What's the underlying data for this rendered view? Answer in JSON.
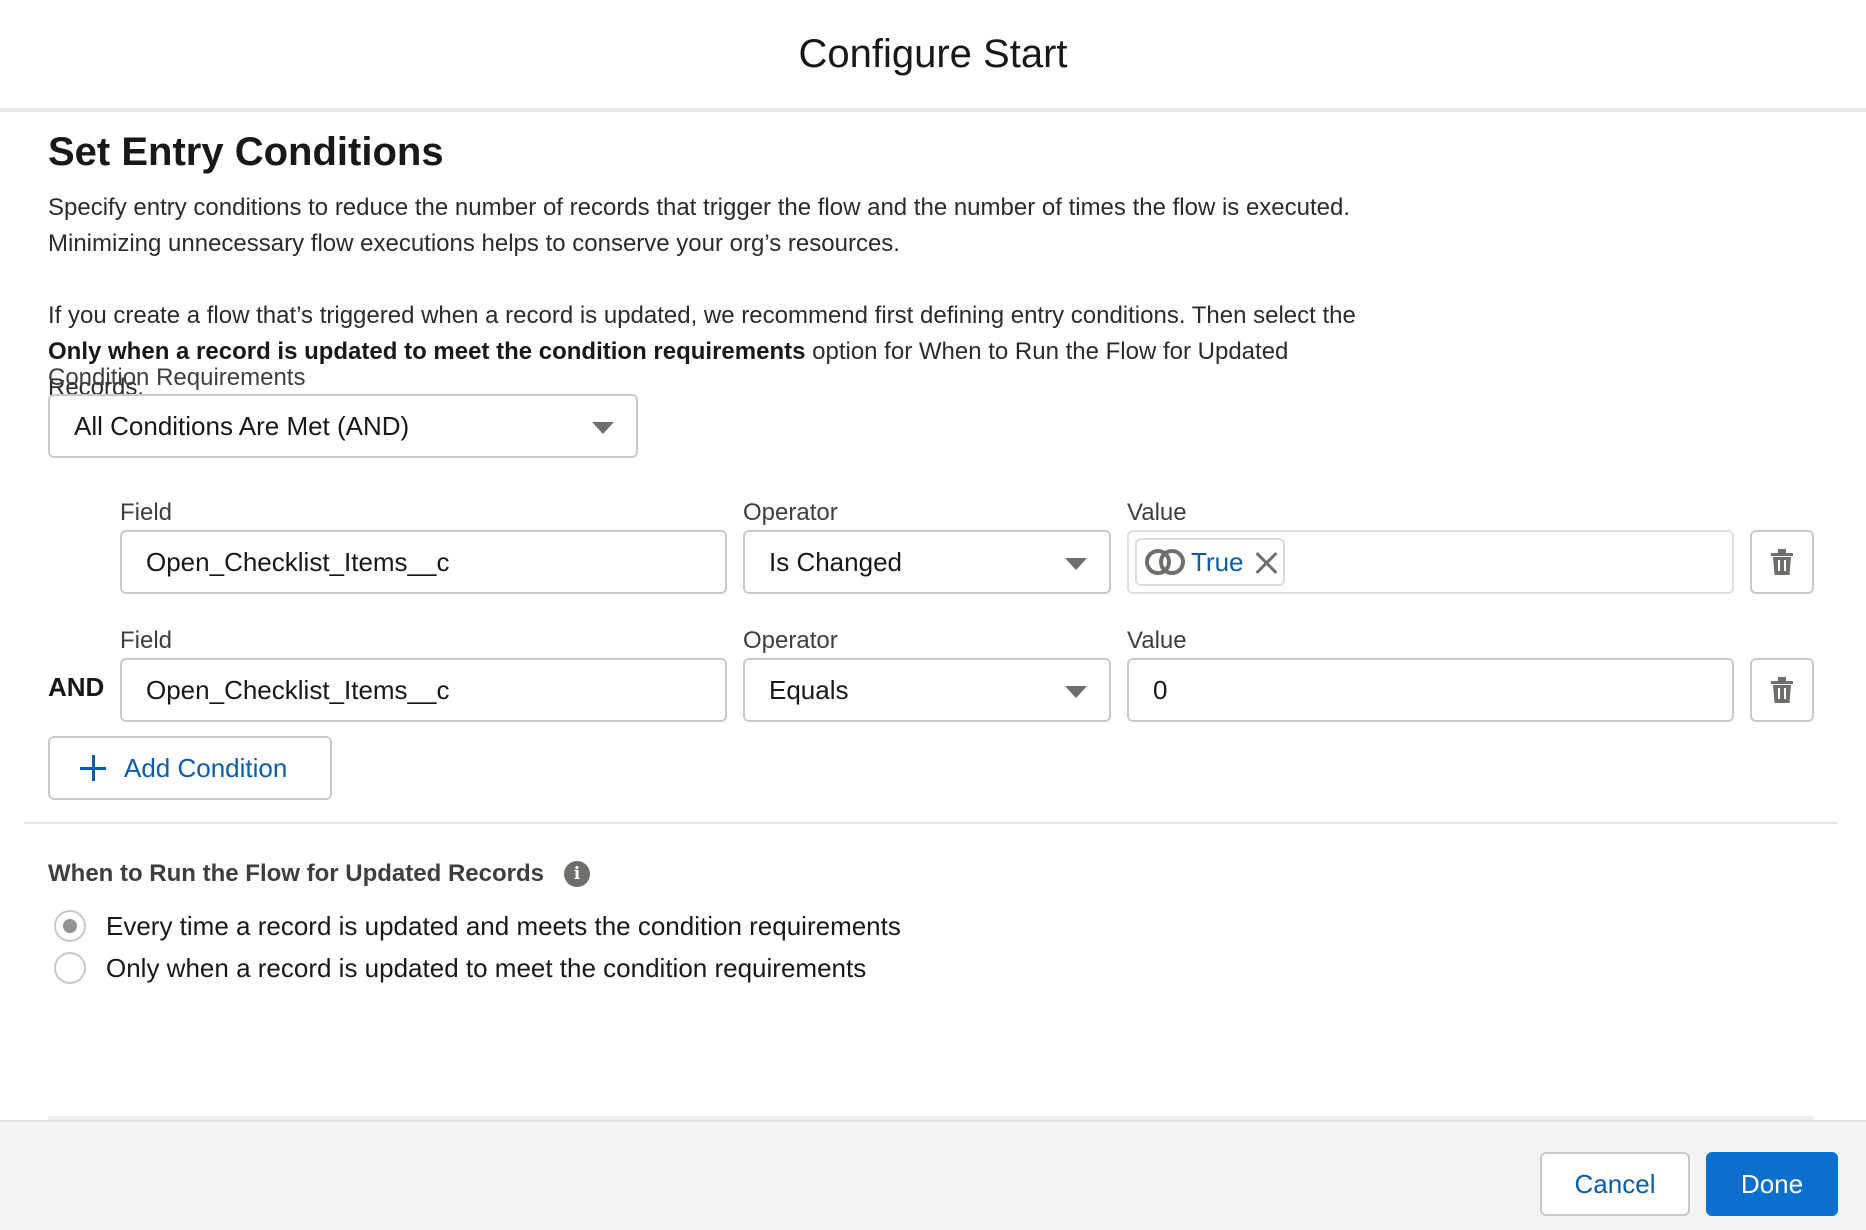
{
  "modal": {
    "title": "Configure Start"
  },
  "entry_conditions": {
    "title": "Set Entry Conditions",
    "paragraph1": "Specify entry conditions to reduce the number of records that trigger the flow and the number of times the flow is executed. Minimizing unnecessary flow executions helps to conserve your org’s resources.",
    "paragraph2_before": "If you create a flow that’s triggered when a record is updated, we recommend first defining entry conditions. Then select the ",
    "paragraph2_bold": "Only when a record is updated to meet the condition requirements",
    "paragraph2_after": " option for When to Run the Flow for Updated Records.",
    "requirements_label": "Condition Requirements",
    "requirements_value": "All Conditions Are Met (AND)"
  },
  "conditions": [
    {
      "field_label": "Field",
      "field_value": "Open_Checklist_Items__c",
      "operator_label": "Operator",
      "operator_value": "Is Changed",
      "value_label": "Value",
      "value_pill": "True"
    },
    {
      "connector": "AND",
      "field_label": "Field",
      "field_value": "Open_Checklist_Items__c",
      "operator_label": "Operator",
      "operator_value": "Equals",
      "value_label": "Value",
      "value_text": "0"
    }
  ],
  "add_condition_label": "Add Condition",
  "run_options": {
    "title": "When to Run the Flow for Updated Records",
    "options": [
      {
        "label": "Every time a record is updated and meets the condition requirements",
        "checked": true
      },
      {
        "label": "Only when a record is updated to meet the condition requirements",
        "checked": false
      }
    ]
  },
  "footer": {
    "cancel_label": "Cancel",
    "done_label": "Done"
  },
  "colors": {
    "brand": "#0b6fd0",
    "link": "#0b5cab"
  }
}
